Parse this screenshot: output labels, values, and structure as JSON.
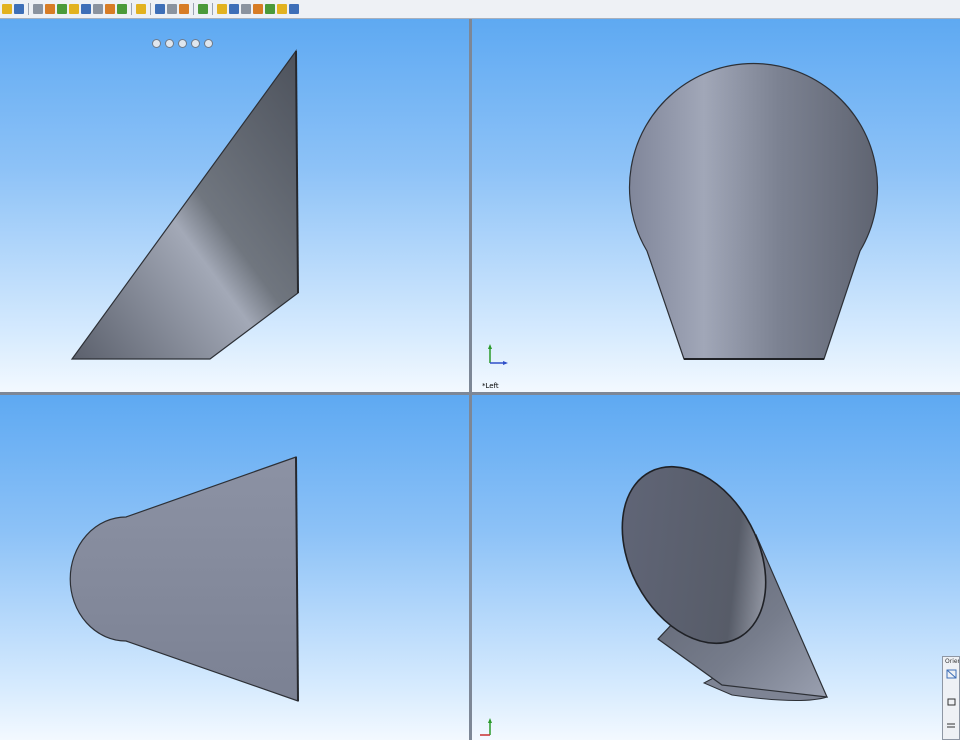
{
  "toolbar": {
    "icon_groups": [
      [
        "view-orientation-icon",
        "display-style-icon"
      ],
      [
        "rotate-view-icon",
        "pan-view-icon",
        "zoom-view-icon",
        "section-view-icon",
        "hide-show-icon",
        "view-settings-icon",
        "lighting-icon",
        "camera-icon"
      ],
      [
        "single-view-icon"
      ],
      [
        "two-view-horizontal-icon",
        "two-view-vertical-icon",
        "four-view-icon"
      ],
      [
        "link-views-icon"
      ],
      [
        "sketch-icon",
        "smart-dimension-icon",
        "relations-icon",
        "features-icon",
        "evaluate-icon",
        "sketch-tools-icon",
        "assembly-icon"
      ]
    ],
    "colors": {
      "yellow": "#e2b21f",
      "blue": "#3d6fb8",
      "gray": "#8a939f",
      "orange": "#d77c25",
      "green": "#4a9a3a"
    }
  },
  "viewports": {
    "top_right": {
      "label": "*Left"
    }
  },
  "orientation_panel": {
    "title": "Orient"
  },
  "colors": {
    "background_top": "#5ea9f2",
    "background_bottom": "#f3f9ff",
    "part_light": "#9aa1b1",
    "part_dark": "#4f545f",
    "divider": "#7d8796"
  }
}
